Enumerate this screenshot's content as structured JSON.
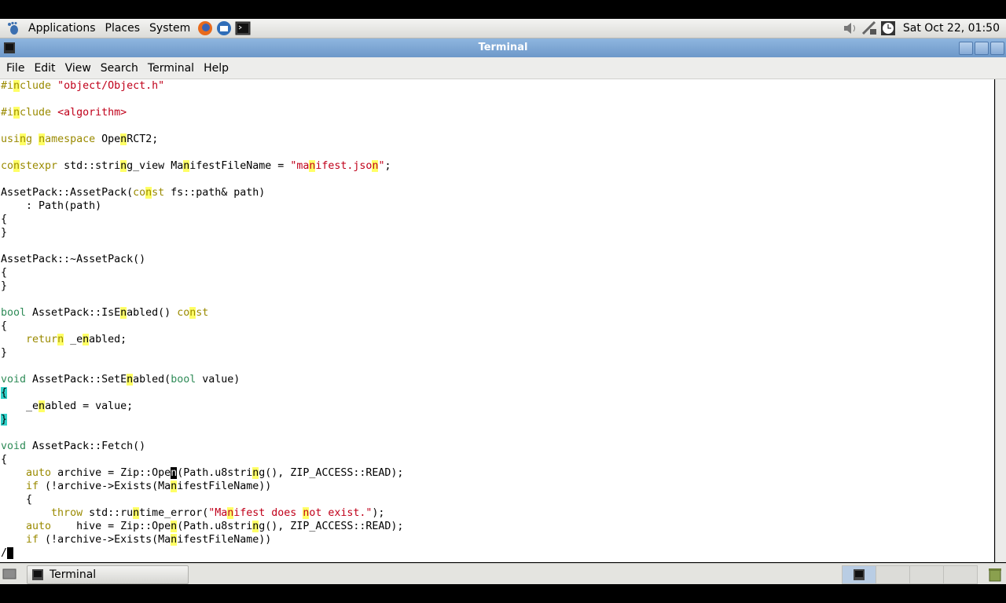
{
  "panel": {
    "menus": [
      "Applications",
      "Places",
      "System"
    ],
    "clock": "Sat Oct 22, 01:50",
    "icons": [
      "gnome-foot-icon",
      "firefox-icon",
      "thunderbird-icon",
      "terminal-launcher-icon",
      "volume-icon",
      "network-icon",
      "clock-icon"
    ]
  },
  "window": {
    "title": "Terminal",
    "menus": [
      "File",
      "Edit",
      "View",
      "Search",
      "Terminal",
      "Help"
    ]
  },
  "taskbar": {
    "task_label": "Terminal",
    "icons": [
      "show-desktop-icon",
      "terminal-task-icon",
      "workspace-switcher",
      "trash-icon"
    ]
  },
  "editor": {
    "lines": [
      "#include \"object/Object.h\"",
      "",
      "#include <algorithm>",
      "",
      "using namespace OpenRCT2;",
      "",
      "constexpr std::string_view ManifestFileName = \"manifest.json\";",
      "",
      "AssetPack::AssetPack(const fs::path& path)",
      "    : Path(path)",
      "{",
      "}",
      "",
      "AssetPack::~AssetPack()",
      "{",
      "}",
      "",
      "bool AssetPack::IsEnabled() const",
      "{",
      "    return _enabled;",
      "}",
      "",
      "void AssetPack::SetEnabled(bool value)",
      "{",
      "    _enabled = value;",
      "}",
      "",
      "void AssetPack::Fetch()",
      "{",
      "    auto archive = Zip::Open(Path.u8string(), ZIP_ACCESS::READ);",
      "    if (!archive->Exists(ManifestFileName))",
      "    {",
      "        throw std::runtime_error(\"Manifest does not exist.\");",
      "    auto    hive = Zip::Open(Path.u8string(), ZIP_ACCESS::READ);",
      "    if (!archive->Exists(ManifestFileName))"
    ],
    "command_line": "/",
    "search_highlight": "n",
    "colors": {
      "keyword": "#9a8a00",
      "type": "#2e8b57",
      "string": "#c0001a",
      "match": "#ffff66",
      "bracket": "#30d0c8"
    }
  }
}
